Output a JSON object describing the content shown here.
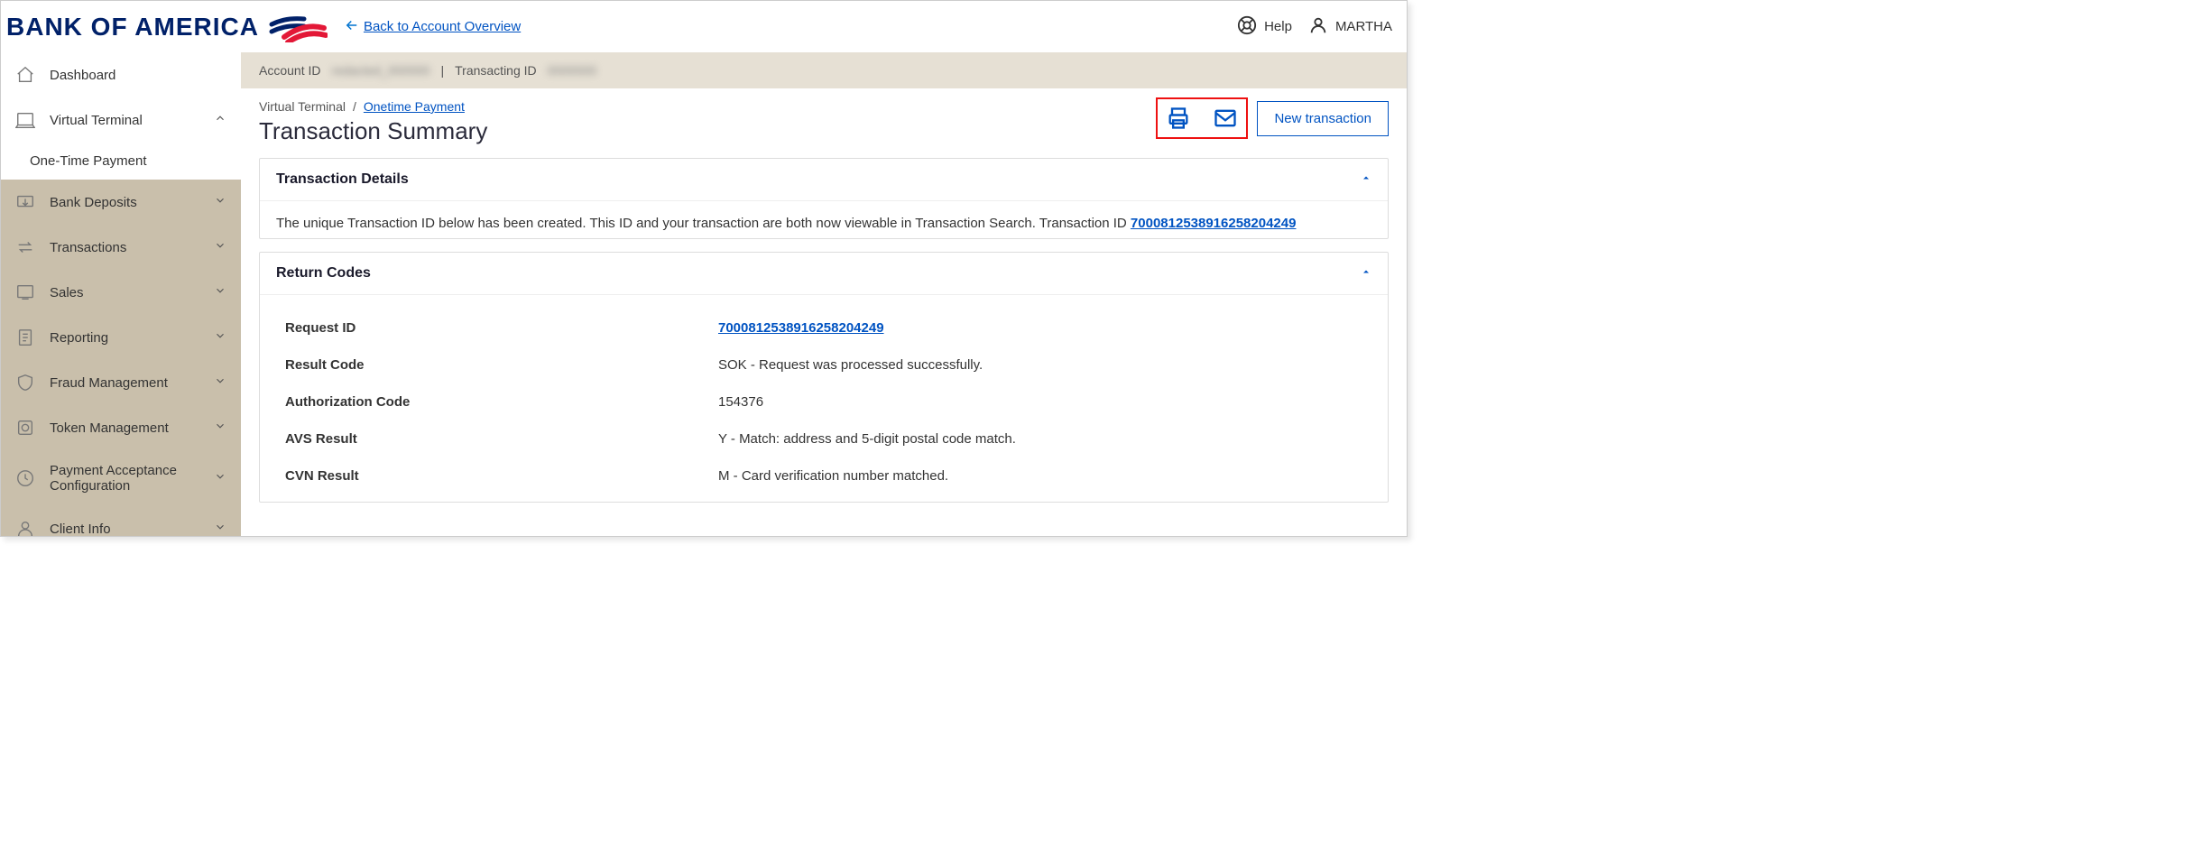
{
  "header": {
    "brand_text": "BANK OF AMERICA",
    "back_link": "Back to Account Overview",
    "help_label": "Help",
    "user_name": "MARTHA"
  },
  "sidebar": {
    "items": [
      {
        "label": "Dashboard",
        "icon": "home"
      },
      {
        "label": "Virtual Terminal",
        "icon": "terminal",
        "expanded": true,
        "children": [
          {
            "label": "One-Time Payment"
          }
        ]
      },
      {
        "label": "Bank Deposits",
        "icon": "deposits"
      },
      {
        "label": "Transactions",
        "icon": "transactions"
      },
      {
        "label": "Sales",
        "icon": "sales"
      },
      {
        "label": "Reporting",
        "icon": "report"
      },
      {
        "label": "Fraud Management",
        "icon": "shield"
      },
      {
        "label": "Token Management",
        "icon": "token"
      },
      {
        "label": "Payment Acceptance Configuration",
        "icon": "config"
      },
      {
        "label": "Client Info",
        "icon": "client"
      }
    ]
  },
  "infobar": {
    "account_id_label": "Account ID",
    "account_id_value": "redacted_000000",
    "sep": "|",
    "transacting_id_label": "Transacting ID",
    "transacting_id_value": "0000000"
  },
  "breadcrumb": {
    "root": "Virtual Terminal",
    "slash": "/",
    "link": "Onetime Payment"
  },
  "page_title": "Transaction Summary",
  "actions": {
    "new_transaction": "New transaction"
  },
  "transaction_details": {
    "title": "Transaction Details",
    "message_prefix": "The unique Transaction ID below has been created. This ID and your transaction are both now viewable in Transaction Search. Transaction ID ",
    "transaction_id": "7000812538916258204249"
  },
  "return_codes": {
    "title": "Return Codes",
    "rows": [
      {
        "k": "Request ID",
        "v": "7000812538916258204249",
        "link": true
      },
      {
        "k": "Result Code",
        "v": "SOK - Request was processed successfully."
      },
      {
        "k": "Authorization Code",
        "v": "154376"
      },
      {
        "k": "AVS Result",
        "v": "Y - Match: address and 5-digit postal code match."
      },
      {
        "k": "CVN Result",
        "v": "M - Card verification number matched."
      }
    ]
  }
}
